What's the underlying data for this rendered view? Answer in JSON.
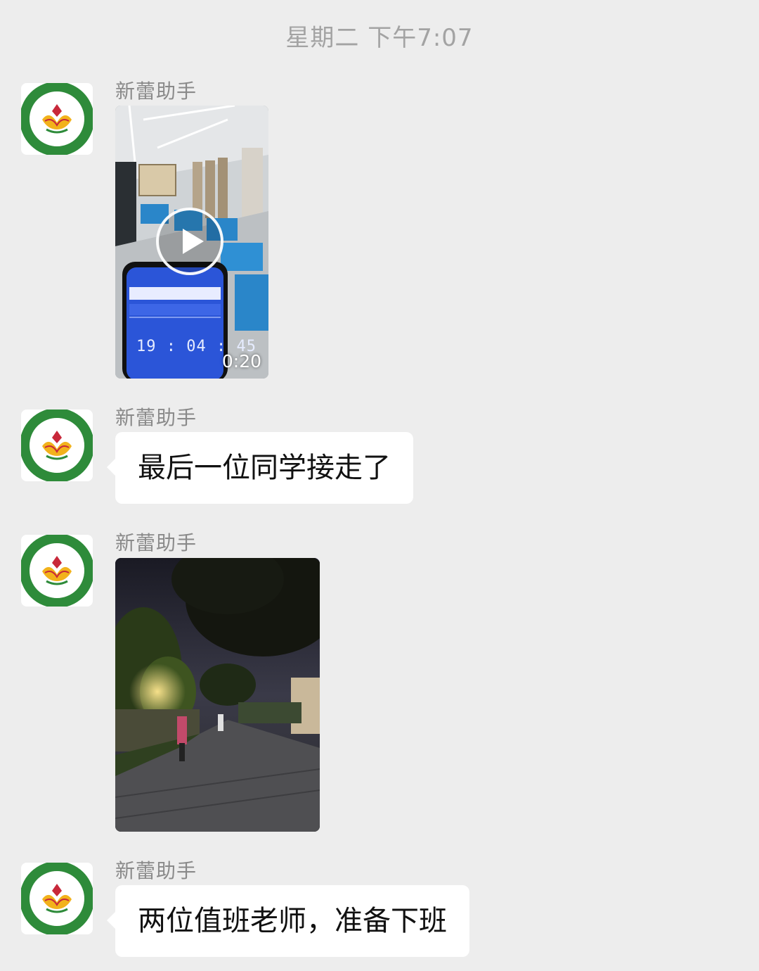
{
  "chat": {
    "timestamp": "星期二 下午7:07",
    "messages": [
      {
        "sender": "新蕾助手",
        "type": "video",
        "duration": "0:20",
        "phone_clock": "19 : 04 : 45"
      },
      {
        "sender": "新蕾助手",
        "type": "text",
        "text": "最后一位同学接走了"
      },
      {
        "sender": "新蕾助手",
        "type": "image"
      },
      {
        "sender": "新蕾助手",
        "type": "text",
        "text": "两位值班老师，准备下班"
      }
    ]
  },
  "colors": {
    "background": "#ededed",
    "bubble": "#ffffff",
    "logo_green": "#2e8b3a",
    "logo_red": "#c8283a",
    "logo_yellow": "#f2b21b"
  }
}
